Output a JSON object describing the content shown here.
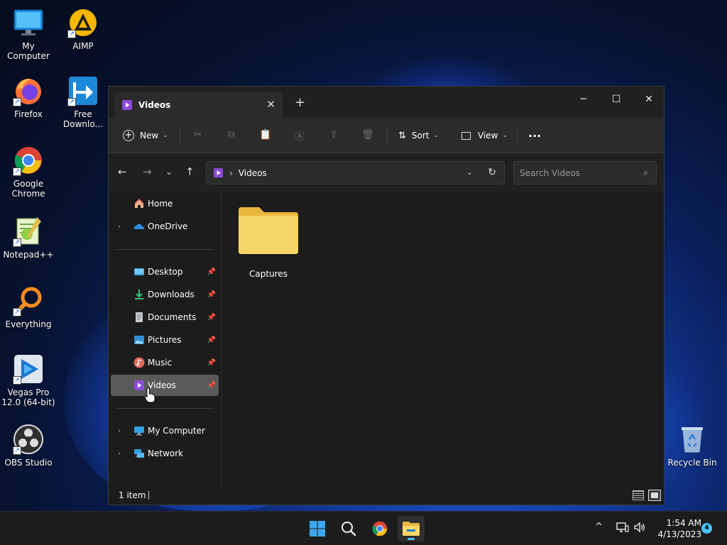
{
  "desktop": {
    "icons": [
      {
        "label": "My Computer"
      },
      {
        "label": "AIMP"
      },
      {
        "label": "Firefox"
      },
      {
        "label": "Free Downlo..."
      },
      {
        "label": "Google Chrome"
      },
      {
        "label": "Notepad++"
      },
      {
        "label": "Everything"
      },
      {
        "label": "Vegas Pro 12.0 (64-bit)"
      },
      {
        "label": "OBS Studio"
      },
      {
        "label": "Recycle Bin"
      }
    ]
  },
  "window": {
    "tab_title": "Videos",
    "toolbar": {
      "new_label": "New",
      "sort_label": "Sort",
      "view_label": "View",
      "more_label": "···"
    },
    "address": {
      "current": "Videos"
    },
    "search": {
      "placeholder": "Search Videos"
    },
    "sidebar": {
      "items": [
        {
          "label": "Home"
        },
        {
          "label": "OneDrive"
        },
        {
          "label": "Desktop"
        },
        {
          "label": "Downloads"
        },
        {
          "label": "Documents"
        },
        {
          "label": "Pictures"
        },
        {
          "label": "Music"
        },
        {
          "label": "Videos"
        },
        {
          "label": "My Computer"
        },
        {
          "label": "Network"
        }
      ]
    },
    "content": {
      "items": [
        {
          "label": "Captures"
        }
      ]
    },
    "status": {
      "item_count": "1 item"
    }
  },
  "taskbar": {
    "time": "1:54 AM",
    "date": "4/13/2023",
    "notifications": "4"
  },
  "colors": {
    "accent": "#4cc2ff",
    "folder": "#f8d568",
    "videos_icon": "#8c4bd8"
  }
}
